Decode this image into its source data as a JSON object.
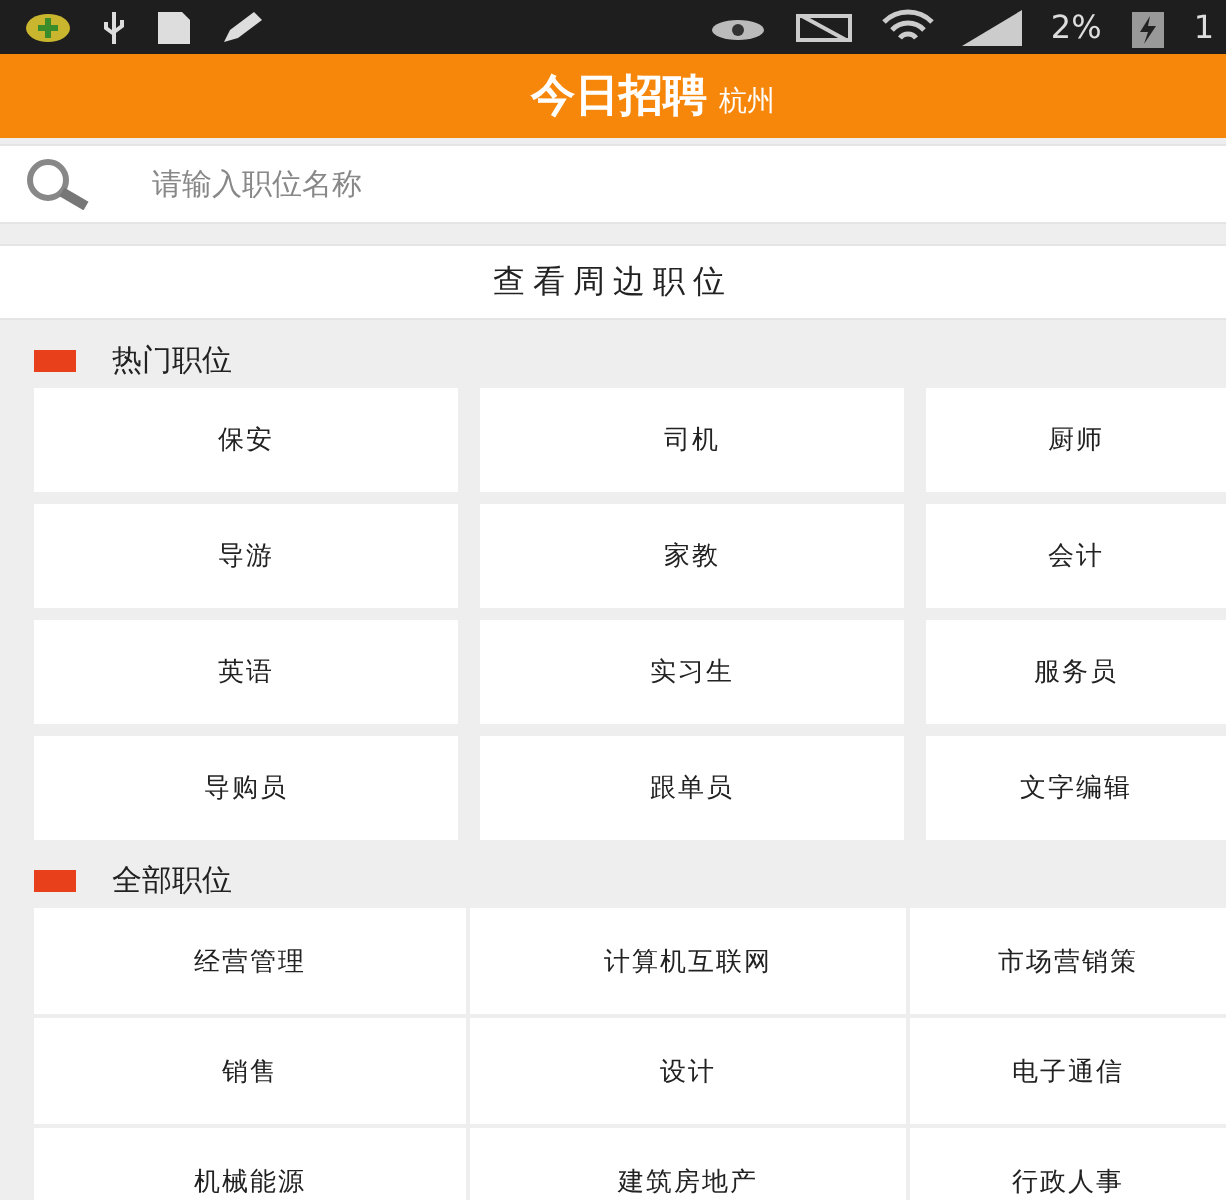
{
  "status_bar": {
    "battery_text": "2%",
    "clock_partial": "1"
  },
  "header": {
    "title": "今日招聘",
    "city": "杭州"
  },
  "search": {
    "placeholder": "请输入职位名称"
  },
  "nearby_button": "查看周边职位",
  "sections": [
    {
      "title": "热门职位",
      "kind": "spaced",
      "items": [
        "保安",
        "司机",
        "厨师",
        "导游",
        "家教",
        "会计",
        "英语",
        "实习生",
        "服务员",
        "导购员",
        "跟单员",
        "文字编辑"
      ]
    },
    {
      "title": "全部职位",
      "kind": "tight",
      "items": [
        "经营管理",
        "计算机互联网",
        "市场营销策",
        "销售",
        "设计",
        "电子通信",
        "机械能源",
        "建筑房地产",
        "行政人事"
      ]
    }
  ]
}
